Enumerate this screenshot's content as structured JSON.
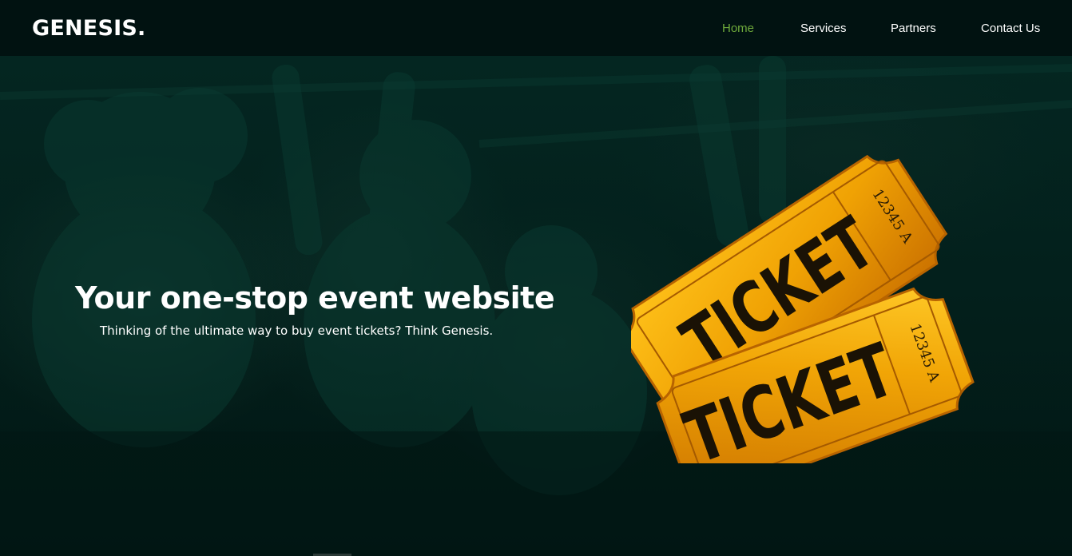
{
  "navbar": {
    "brand": "GENESIS.",
    "links": [
      {
        "label": "Home",
        "active": true
      },
      {
        "label": "Services",
        "active": false
      },
      {
        "label": "Partners",
        "active": false
      },
      {
        "label": "Contact Us",
        "active": false
      }
    ]
  },
  "hero": {
    "title": "Your one-stop event website",
    "subtitle": "Thinking of the ultimate way to buy event tickets? Think Genesis.",
    "background": "crowd-photo",
    "image": "ticket-icon",
    "ticket_back": {
      "label": "TICKET",
      "number": "12345 A"
    },
    "ticket_front": {
      "label": "TICKET",
      "number": "12345 A"
    }
  },
  "colors": {
    "accent": "#6ea93b",
    "navbar_bg": "#011211",
    "hero_bg": "#042621",
    "ticket_gold": "#f2a607",
    "ticket_dark": "#c26c00"
  }
}
